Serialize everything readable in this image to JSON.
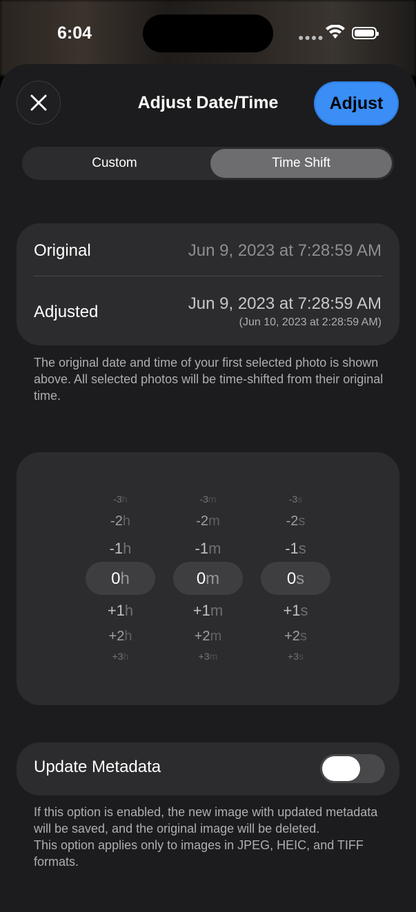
{
  "status": {
    "time": "6:04"
  },
  "header": {
    "title": "Adjust Date/Time",
    "adjust_label": "Adjust"
  },
  "segment": {
    "options": [
      "Custom",
      "Time Shift"
    ],
    "selected": "Time Shift"
  },
  "summary": {
    "original_label": "Original",
    "original_value": "Jun 9, 2023 at 7:28:59 AM",
    "adjusted_label": "Adjusted",
    "adjusted_value": "Jun 9, 2023 at 7:28:59 AM",
    "adjusted_sub": "(Jun 10, 2023 at 2:28:59 AM)"
  },
  "note1": "The original date and time of your first selected photo is shown above. All selected photos will be time-shifted from their original time.",
  "picker": {
    "hours": {
      "unit": "h",
      "values": [
        "-3",
        "-2",
        "-1",
        "0",
        "+1",
        "+2",
        "+3"
      ],
      "selected": "0"
    },
    "minutes": {
      "unit": "m",
      "values": [
        "-3",
        "-2",
        "-1",
        "0",
        "+1",
        "+2",
        "+3"
      ],
      "selected": "0"
    },
    "seconds": {
      "unit": "s",
      "values": [
        "-3",
        "-2",
        "-1",
        "0",
        "+1",
        "+2",
        "+3"
      ],
      "selected": "0"
    }
  },
  "metadata": {
    "label": "Update Metadata",
    "enabled": false
  },
  "note2_line1": "If this option is enabled, the new image with updated metadata will be saved, and the original image will be deleted.",
  "note2_line2": "This option applies only to images in JPEG, HEIC, and TIFF formats.",
  "icons": {
    "close": "close-icon",
    "wifi": "wifi-icon",
    "battery": "battery-icon"
  },
  "colors": {
    "accent": "#3a8ef5",
    "sheet": "#1c1c1e",
    "card": "#2c2c2e"
  }
}
